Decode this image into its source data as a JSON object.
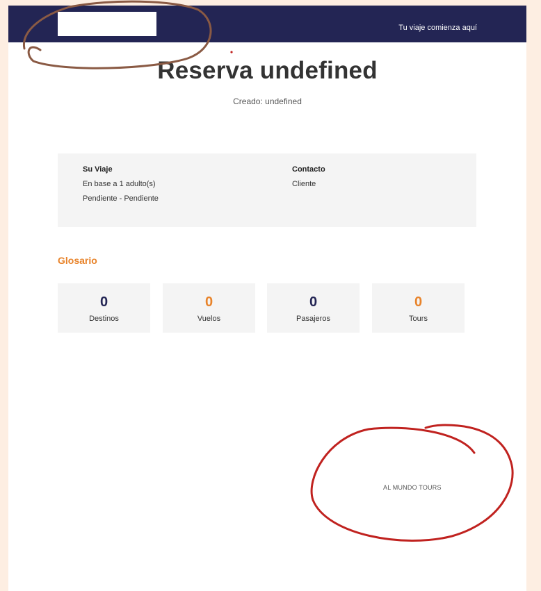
{
  "header": {
    "tagline": "Tu viaje comienza aquí"
  },
  "booking": {
    "title": "Reserva undefined",
    "created": "Creado: undefined"
  },
  "trip": {
    "heading": "Su Viaje",
    "line1": "En base a 1 adulto(s)",
    "line2": "Pendiente - Pendiente"
  },
  "contact": {
    "heading": "Contacto",
    "line1": "Cliente"
  },
  "glossary": {
    "heading": "Glosario",
    "stats": [
      {
        "value": "0",
        "label": "Destinos",
        "color": "#232554"
      },
      {
        "value": "0",
        "label": "Vuelos",
        "color": "#e8832a"
      },
      {
        "value": "0",
        "label": "Pasajeros",
        "color": "#232554"
      },
      {
        "value": "0",
        "label": "Tours",
        "color": "#e8832a"
      }
    ]
  },
  "footer": {
    "brand": "AL MUNDO TOURS"
  },
  "annotations": {
    "brown_stroke": "#8a5a44",
    "red_stroke": "#c0221f"
  }
}
